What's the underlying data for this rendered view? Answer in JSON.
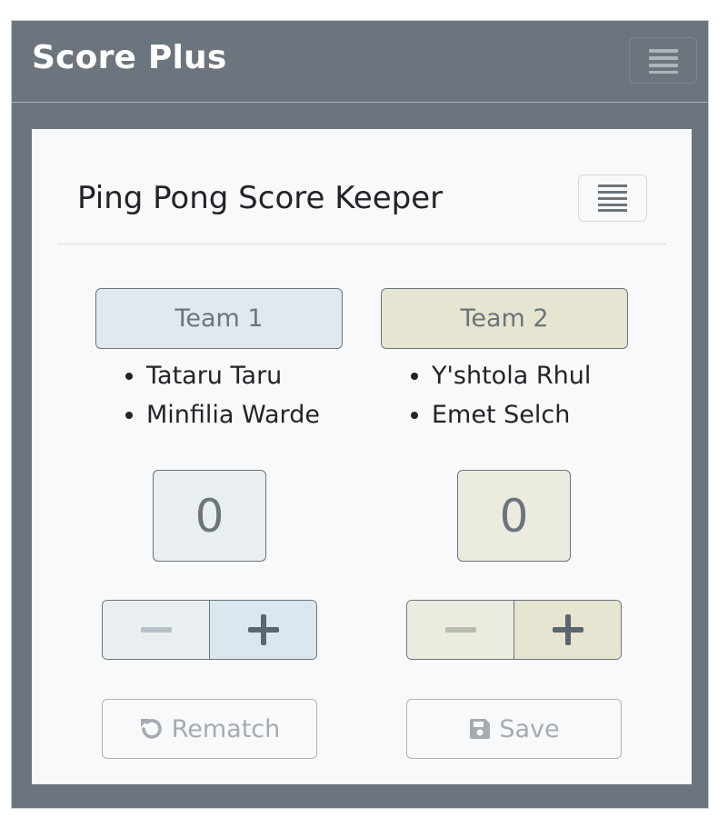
{
  "app": {
    "brand": "Score Plus",
    "menu_icon": "hamburger-icon"
  },
  "card": {
    "title": "Ping Pong Score Keeper",
    "menu_icon": "list-icon"
  },
  "teams": [
    {
      "label": "Team 1",
      "players": [
        "Tataru Taru",
        "Minfilia Warde"
      ],
      "score": "0",
      "color": "#e2e8ef"
    },
    {
      "label": "Team 2",
      "players": [
        "Y'shtola Rhul",
        "Emet Selch"
      ],
      "score": "0",
      "color": "#e5e5d1"
    }
  ],
  "actions": {
    "rematch_label": "Rematch",
    "rematch_icon": "undo-icon",
    "save_label": "Save",
    "save_icon": "floppy-disk-icon"
  },
  "colors": {
    "navbar": "#6c757d",
    "card": "#f8f9fa",
    "text": "#212529",
    "muted": "#6c757d"
  }
}
